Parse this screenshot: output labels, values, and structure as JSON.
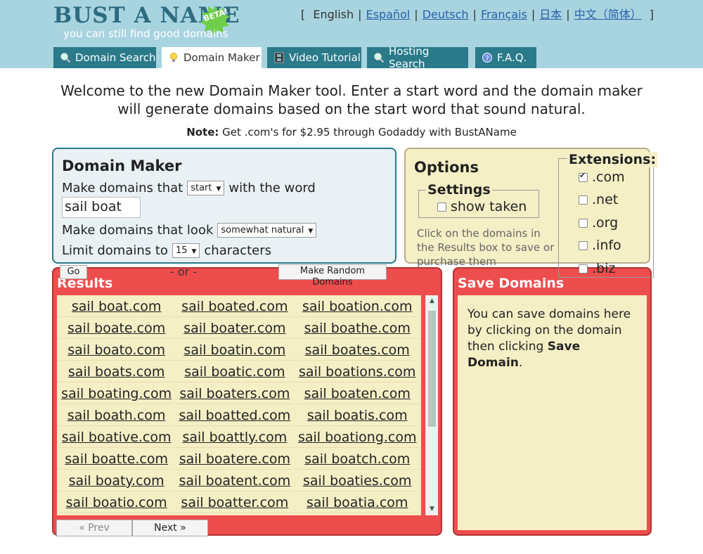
{
  "logo": {
    "title": "BUST A NAME",
    "badge": "BETA!",
    "tagline": "you can still find good domains"
  },
  "languages": {
    "open": "[",
    "close": "]",
    "items": [
      "English",
      "Español",
      "Deutsch",
      "Français",
      "日本",
      "中文（简体）"
    ]
  },
  "tabs": [
    {
      "label": "Domain Search",
      "icon": "magnifier-icon"
    },
    {
      "label": "Domain Maker",
      "icon": "lightbulb-icon"
    },
    {
      "label": "Video Tutorial",
      "icon": "film-icon"
    },
    {
      "label": "Hosting Search",
      "icon": "magnifier-icon"
    },
    {
      "label": "F.A.Q.",
      "icon": "help-icon"
    }
  ],
  "intro": {
    "welcome": "Welcome to the new Domain Maker tool. Enter a start word and the domain maker will generate domains based on the start word that sound natural.",
    "note_label": "Note:",
    "note_text": "Get .com's for $2.95 through Godaddy with BustAName"
  },
  "maker": {
    "title": "Domain Maker",
    "row1_prefix": "Make domains that",
    "position_value": "start",
    "row1_suffix": "with the word",
    "word_value": "sail boat",
    "row2_prefix": "Make domains that look",
    "look_value": "somewhat natural",
    "row3_prefix": "Limit domains to",
    "limit_value": "15",
    "row3_suffix": "characters",
    "go_label": "Go",
    "or_label": "- or -",
    "random_label_1": "Make Random",
    "random_label_2": "Domains"
  },
  "options": {
    "title": "Options",
    "settings_legend": "Settings",
    "show_taken_label": "show taken",
    "show_taken_checked": false,
    "help": "Click on the domains in the Results box to save or purchase them",
    "extensions_legend": "Extensions:",
    "extensions": [
      {
        "label": ".com",
        "checked": true
      },
      {
        "label": ".net",
        "checked": false
      },
      {
        "label": ".org",
        "checked": false
      },
      {
        "label": ".info",
        "checked": false
      },
      {
        "label": ".biz",
        "checked": false
      }
    ]
  },
  "results": {
    "title": "Results",
    "rows": [
      [
        "sail boat.com",
        "sail boated.com",
        "sail boation.com"
      ],
      [
        "sail boate.com",
        "sail boater.com",
        "sail boathe.com"
      ],
      [
        "sail boato.com",
        "sail boatin.com",
        "sail boates.com"
      ],
      [
        "sail boats.com",
        "sail boatic.com",
        "sail boations.com"
      ],
      [
        "sail boating.com",
        "sail boaters.com",
        "sail boaten.com"
      ],
      [
        "sail boath.com",
        "sail boatted.com",
        "sail boatis.com"
      ],
      [
        "sail boative.com",
        "sail boattly.com",
        "sail boationg.com"
      ],
      [
        "sail boatte.com",
        "sail boatere.com",
        "sail boatch.com"
      ],
      [
        "sail boaty.com",
        "sail boatent.com",
        "sail boaties.com"
      ],
      [
        "sail boatio.com",
        "sail boatter.com",
        "sail boatia.com"
      ]
    ],
    "prev_label": "« Prev",
    "next_label": "Next »"
  },
  "save": {
    "title": "Save Domains",
    "text": "You can save domains here by clicking on the domain then clicking",
    "text_bold": "Save Domain",
    "text_end": "."
  },
  "colors": {
    "header_bg": "#a8d4e0",
    "tab_bg": "#2a7a8a",
    "results_red": "#ee4d4d",
    "cream": "#f5efc6",
    "link_blue": "#2a5fa8"
  }
}
